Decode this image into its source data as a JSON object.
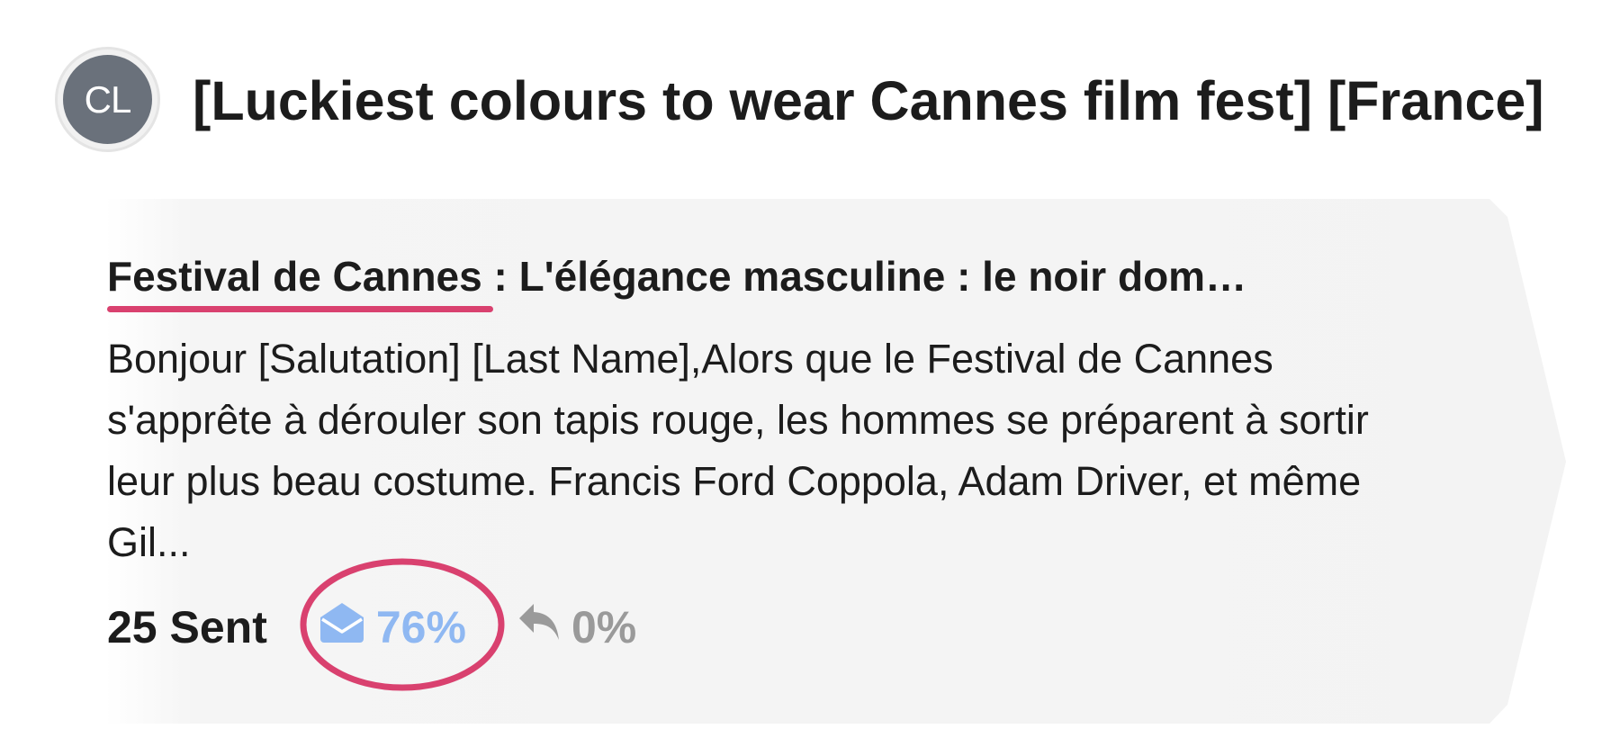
{
  "header": {
    "avatar_initials": "CL",
    "title": "[Luckiest colours to wear Cannes film fest] [France]"
  },
  "card": {
    "subject_highlight": "Festival de Cannes",
    "subject_rest": " : L'élégance masculine : le noir dom…",
    "preview": "Bonjour [Salutation] [Last Name],Alors que le Festival de Cannes s'apprête à dérouler son tapis rouge, les hommes se préparent à sortir leur plus beau costume. Francis Ford Coppola, Adam Driver, et même Gil...",
    "stats": {
      "sent": "25 Sent",
      "opened": "76%",
      "replied": "0%"
    }
  },
  "colors": {
    "accent_annotation": "#d9416f",
    "opened": "#8fb8f2",
    "replied": "#9a9a9a",
    "avatar": "#6a717b"
  },
  "icons": {
    "opened": "envelope-open-icon",
    "replied": "reply-icon"
  }
}
